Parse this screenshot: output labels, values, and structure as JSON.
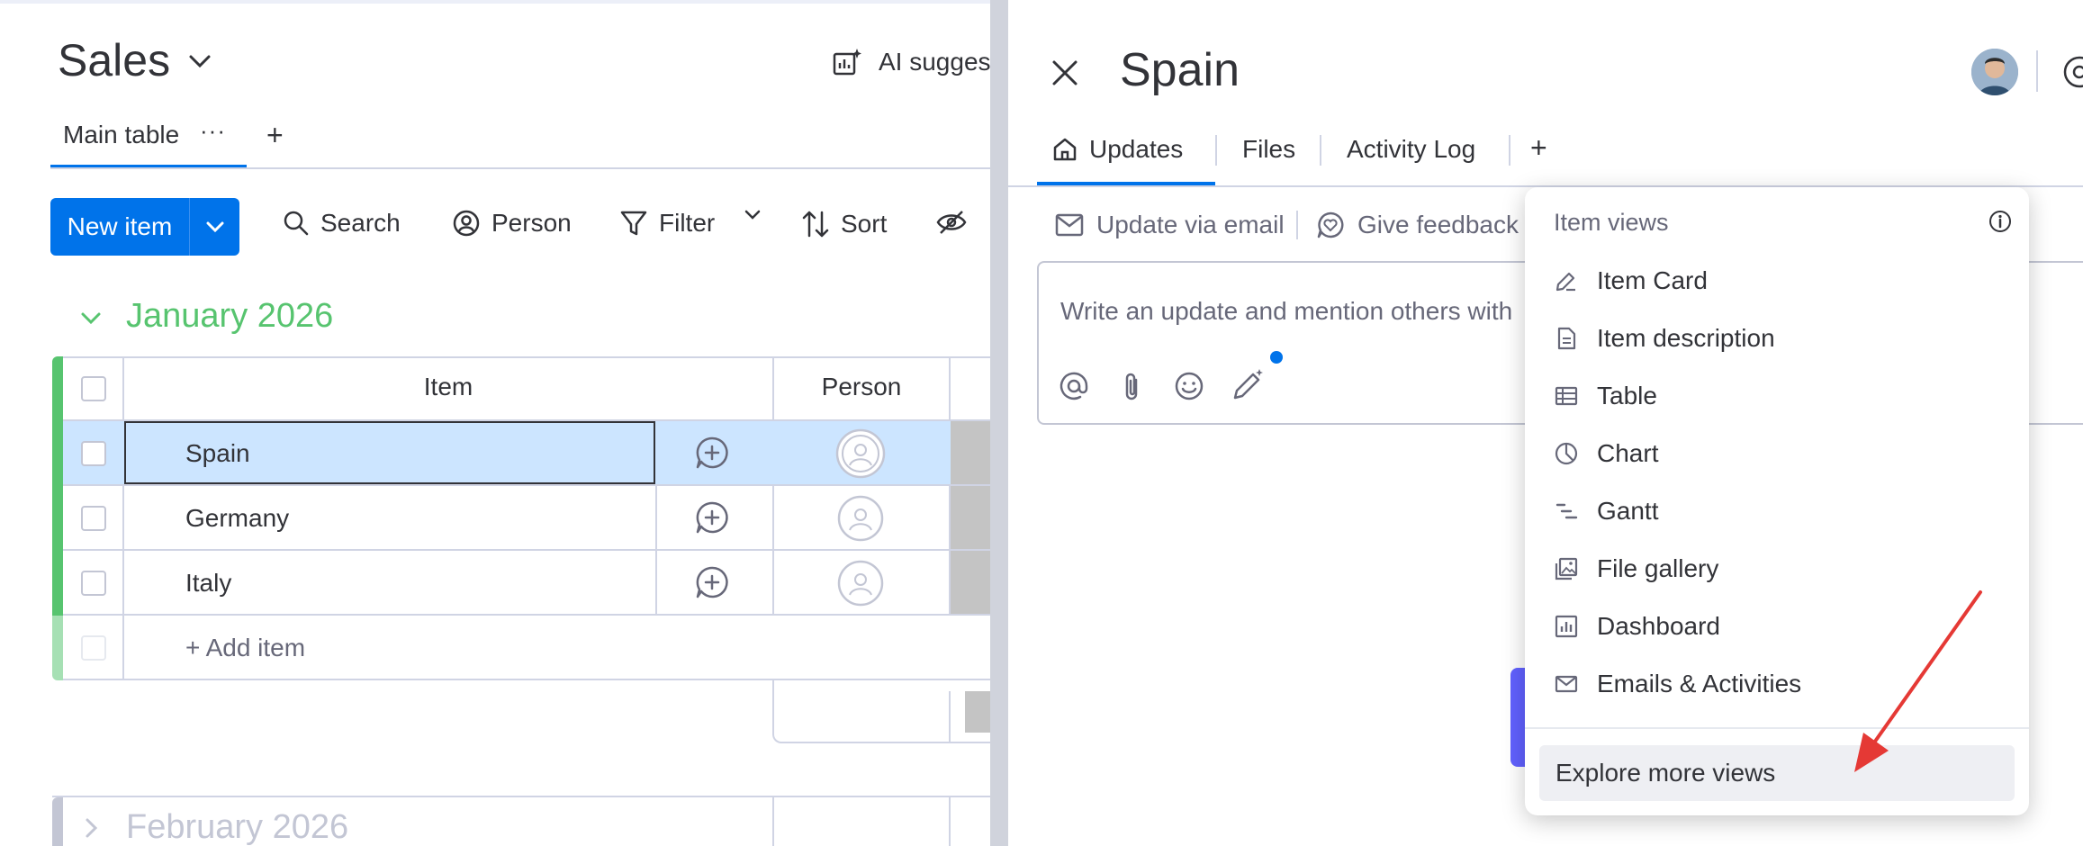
{
  "board": {
    "title": "Sales",
    "ai_suggest_label": "AI sugges",
    "view_tab_label": "Main table",
    "new_item_label": "New item",
    "toolbar": {
      "search": "Search",
      "person": "Person",
      "filter": "Filter",
      "sort": "Sort"
    },
    "group": {
      "title": "January 2026",
      "color": "#57c46f",
      "columns": {
        "item": "Item",
        "person": "Person"
      },
      "rows": [
        {
          "name": "Spain",
          "selected": true
        },
        {
          "name": "Germany",
          "selected": false
        },
        {
          "name": "Italy",
          "selected": false
        }
      ],
      "add_item_label": "+ Add item"
    },
    "next_group_title": "February 2026"
  },
  "panel": {
    "title": "Spain",
    "tabs": [
      {
        "label": "Updates",
        "icon": "home-icon",
        "active": true
      },
      {
        "label": "Files",
        "active": false
      },
      {
        "label": "Activity Log",
        "active": false
      }
    ],
    "add_tab_label": "+",
    "update_via_email": "Update via email",
    "give_feedback": "Give feedback",
    "editor_placeholder": "Write an update and mention others with"
  },
  "dropdown": {
    "header": "Item views",
    "items": [
      {
        "label": "Item Card",
        "icon": "pencil-icon"
      },
      {
        "label": "Item description",
        "icon": "document-icon"
      },
      {
        "label": "Table",
        "icon": "table-icon"
      },
      {
        "label": "Chart",
        "icon": "chart-icon"
      },
      {
        "label": "Gantt",
        "icon": "gantt-icon"
      },
      {
        "label": "File gallery",
        "icon": "gallery-icon"
      },
      {
        "label": "Dashboard",
        "icon": "dashboard-icon"
      },
      {
        "label": "Emails & Activities",
        "icon": "mail-icon"
      }
    ],
    "explore_label": "Explore more views"
  },
  "colors": {
    "primary": "#0073ea",
    "group_green": "#57c46f",
    "selected_row": "#cce5ff",
    "annotation_arrow": "#e53935"
  }
}
